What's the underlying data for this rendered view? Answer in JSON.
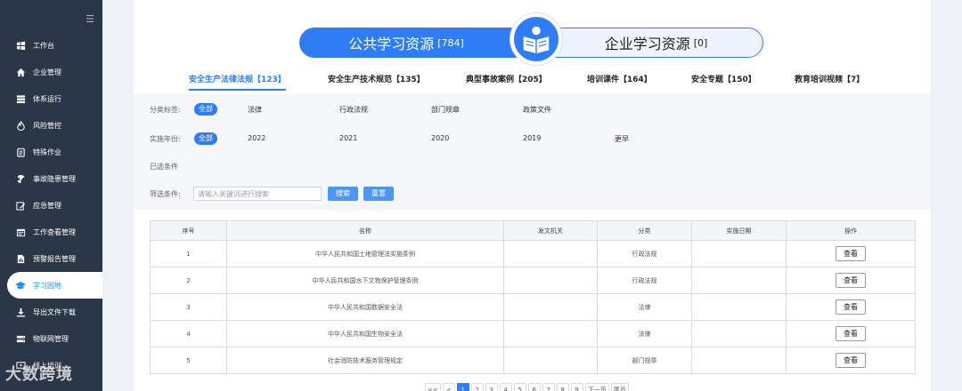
{
  "sidebar": {
    "items": [
      {
        "label": "工作台",
        "icon": "dashboard-icon"
      },
      {
        "label": "企业管理",
        "icon": "home-icon"
      },
      {
        "label": "体系运行",
        "icon": "layers-icon"
      },
      {
        "label": "风险管控",
        "icon": "flame-icon"
      },
      {
        "label": "特殊作业",
        "icon": "clipboard-icon"
      },
      {
        "label": "事故隐患管理",
        "icon": "radiation-icon"
      },
      {
        "label": "应急管理",
        "icon": "edit-icon"
      },
      {
        "label": "工作查看管理",
        "icon": "calendar-icon"
      },
      {
        "label": "预警报告管理",
        "icon": "report-icon"
      },
      {
        "label": "学习园地",
        "icon": "graduation-cap-icon",
        "active": true
      },
      {
        "label": "导出文件下载",
        "icon": "download-icon"
      },
      {
        "label": "物联网管理",
        "icon": "iot-icon"
      },
      {
        "label": "线上培训",
        "icon": "training-icon"
      }
    ],
    "watermark": "大数跨境"
  },
  "switch": {
    "public_label": "公共学习资源",
    "public_count": "[784]",
    "enterprise_label": "企业学习资源",
    "enterprise_count": "[0]"
  },
  "tabs": [
    {
      "label": "安全生产法律法规【123】",
      "active": true
    },
    {
      "label": "安全生产技术规范【135】"
    },
    {
      "label": "典型事故案例【205】"
    },
    {
      "label": "培训课件【164】"
    },
    {
      "label": "安全专题【150】"
    },
    {
      "label": "教育培训视频【7】"
    }
  ],
  "filter": {
    "category_label": "分类标签:",
    "category_all": "全部",
    "category_options": [
      "法律",
      "行政法规",
      "部门规章",
      "政策文件"
    ],
    "year_label": "实施年份:",
    "year_all": "全部",
    "year_options": [
      "2022",
      "2021",
      "2020",
      "2019",
      "更早"
    ],
    "selected_label": "已选条件",
    "search_label": "筛选条件:",
    "search_placeholder": "请输入关键词进行搜索",
    "search_button": "搜索",
    "reset_button": "重置"
  },
  "table": {
    "headers": [
      "序号",
      "名称",
      "发文机关",
      "分类",
      "实施日期",
      "操作"
    ],
    "view_label": "查看",
    "rows": [
      {
        "no": "1",
        "name": "中华人民共和国土地管理法实施条例",
        "issuer": "",
        "category": "行政法规",
        "date": ""
      },
      {
        "no": "2",
        "name": "中华人民共和国水下文物保护管理条例",
        "issuer": "",
        "category": "行政法规",
        "date": ""
      },
      {
        "no": "3",
        "name": "中华人民共和国数据安全法",
        "issuer": "",
        "category": "法律",
        "date": ""
      },
      {
        "no": "4",
        "name": "中华人民共和国生物安全法",
        "issuer": "",
        "category": "法律",
        "date": ""
      },
      {
        "no": "5",
        "name": "社会消防技术服务管理规定",
        "issuer": "",
        "category": "部门规章",
        "date": ""
      }
    ]
  },
  "pager": {
    "items": [
      "<<",
      "<",
      "1",
      "2",
      "3",
      "4",
      "5",
      "6",
      "7",
      "8",
      "9",
      "下一页",
      "尾页"
    ],
    "current": "1"
  },
  "colors": {
    "accent": "#2f7df6",
    "sidebar_bg": "#2b3646"
  }
}
